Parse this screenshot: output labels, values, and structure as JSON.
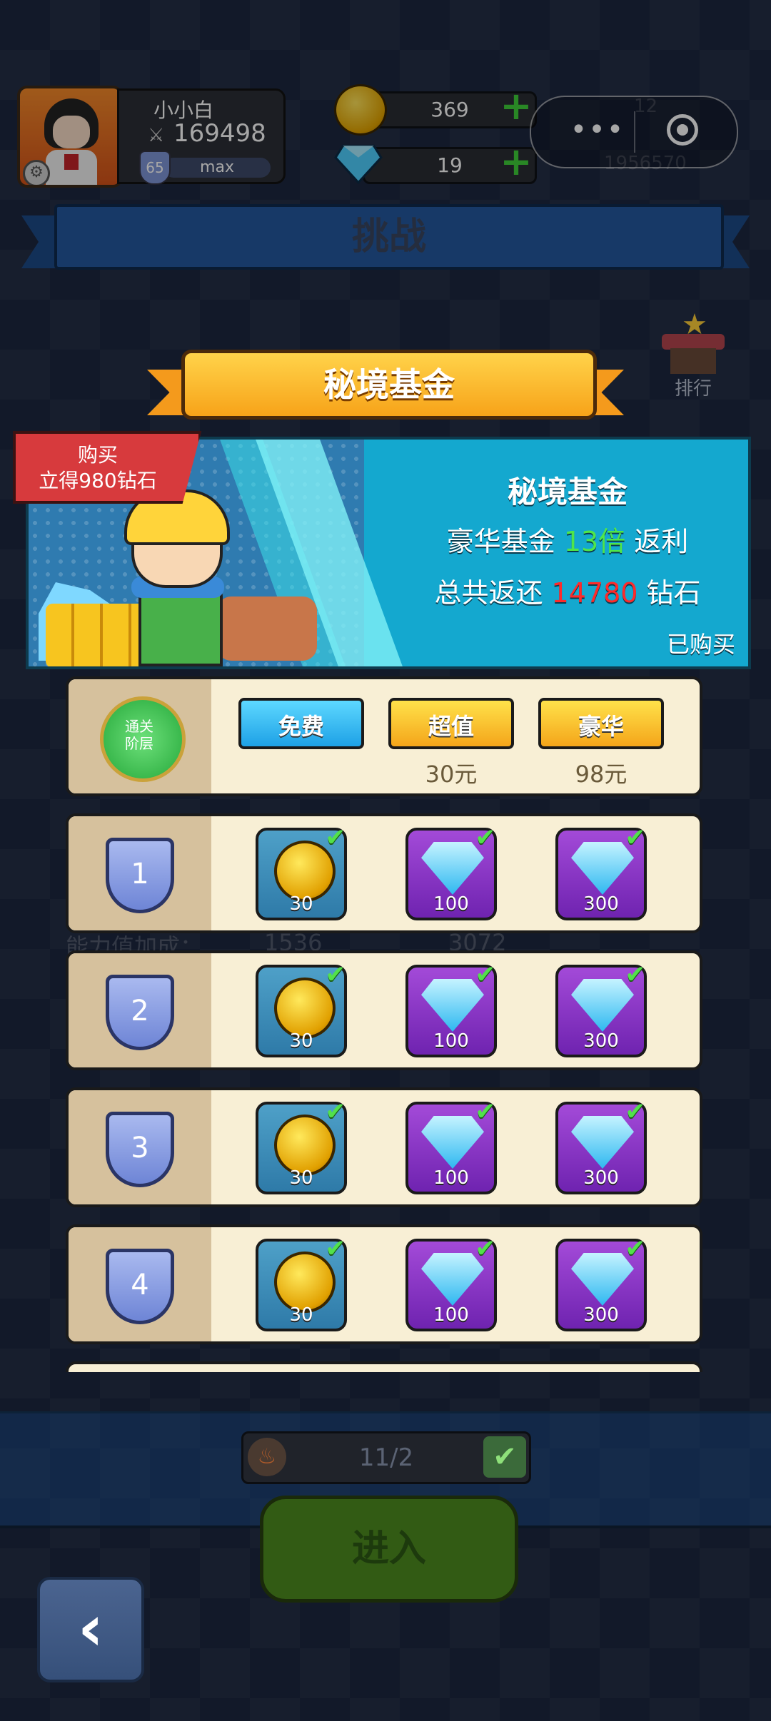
{
  "player": {
    "name": "小小白",
    "power": "169498",
    "level": "65",
    "level_status": "max"
  },
  "currencies": {
    "gold": "369",
    "diamonds": "19"
  },
  "ghost_currencies": {
    "top": "12",
    "bottom": "1956570"
  },
  "mini_program_menu": {
    "more": "•••"
  },
  "page_title": "挑战",
  "ranking": {
    "label": "排行"
  },
  "modal": {
    "title": "秘境基金",
    "purchase_tag": {
      "line1": "购买",
      "line2": "立得980钻石"
    },
    "banner": {
      "title": "秘境基金",
      "line2_prefix": "豪华基金 ",
      "multiplier": "13倍",
      "line2_suffix": " 返利",
      "line3_prefix": "总共返还 ",
      "total": "14780",
      "line3_suffix": " 钻石",
      "status": "已购买"
    },
    "header": {
      "badge_label_1": "通关",
      "badge_label_2": "阶层",
      "tiers": [
        {
          "name": "免费",
          "price": "",
          "color": "#1ea1e6"
        },
        {
          "name": "超值",
          "price": "30元",
          "color": "#f4a51a"
        },
        {
          "name": "豪华",
          "price": "98元",
          "color": "#f4a51a"
        }
      ]
    },
    "rows": [
      {
        "level": "1",
        "rewards": [
          {
            "type": "coin",
            "amount": "30"
          },
          {
            "type": "gem",
            "amount": "100"
          },
          {
            "type": "gem",
            "amount": "300"
          }
        ]
      },
      {
        "level": "2",
        "rewards": [
          {
            "type": "coin",
            "amount": "30"
          },
          {
            "type": "gem",
            "amount": "100"
          },
          {
            "type": "gem",
            "amount": "300"
          }
        ]
      },
      {
        "level": "3",
        "rewards": [
          {
            "type": "coin",
            "amount": "30"
          },
          {
            "type": "gem",
            "amount": "100"
          },
          {
            "type": "gem",
            "amount": "300"
          }
        ]
      },
      {
        "level": "4",
        "rewards": [
          {
            "type": "coin",
            "amount": "30"
          },
          {
            "type": "gem",
            "amount": "100"
          },
          {
            "type": "gem",
            "amount": "300"
          }
        ]
      }
    ]
  },
  "background_text": {
    "power_bonus": "能力值加成：",
    "val1": "1536",
    "val2": "3072"
  },
  "entry_counter": {
    "value": "11/2"
  },
  "enter_button": {
    "label": "进入"
  },
  "back_button": {
    "icon": "‹"
  }
}
